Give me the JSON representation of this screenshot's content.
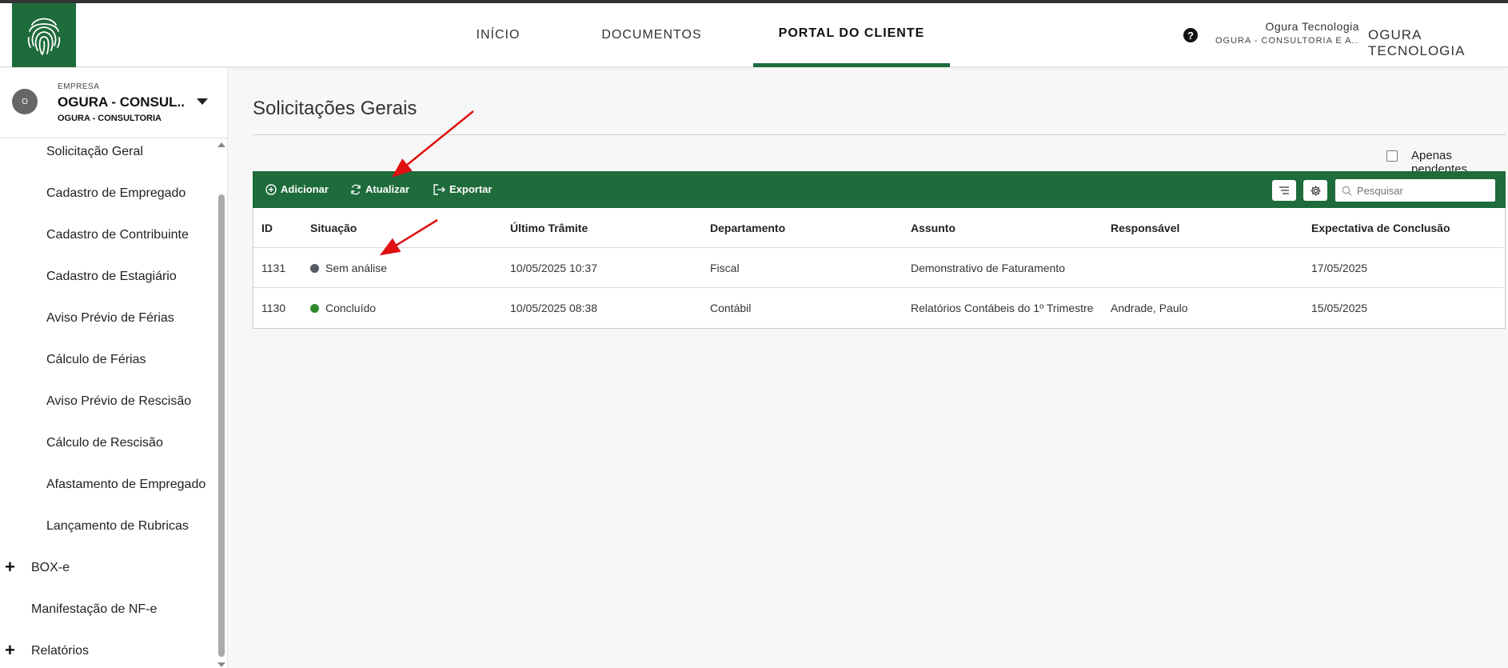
{
  "colors": {
    "brand": "#1e6b3c",
    "status_grey": "#555a63",
    "status_green": "#2f8a2b",
    "annotation_arrow": "#e01010"
  },
  "header": {
    "nav": [
      "INÍCIO",
      "DOCUMENTOS",
      "PORTAL DO CLIENTE"
    ],
    "active_nav": "PORTAL DO CLIENTE",
    "help_glyph": "?",
    "user_name": "Ogura Tecnologia",
    "user_company": "OGURA - CONSULTORIA E A...",
    "company_right": "OGURA TECNOLOGIA"
  },
  "sidebar": {
    "avatar": "O",
    "company_label": "EMPRESA",
    "company_name": "OGURA - CONSUL...",
    "company_sub": "OGURA - CONSULTORIA",
    "items": [
      "Solicitação Geral",
      "Cadastro de Empregado",
      "Cadastro de Contribuinte",
      "Cadastro de Estagiário",
      "Aviso Prévio de Férias",
      "Cálculo de Férias",
      "Aviso Prévio de Rescisão",
      "Cálculo de Rescisão",
      "Afastamento de Empregado",
      "Lançamento de Rubricas"
    ],
    "sections": [
      "BOX-e",
      "Manifestação de NF-e",
      "Relatórios"
    ]
  },
  "main": {
    "title": "Solicitações Gerais",
    "pending_label": "Apenas pendentes",
    "toolbar": {
      "add": "Adicionar",
      "refresh": "Atualizar",
      "export": "Exportar",
      "search_placeholder": "Pesquisar"
    },
    "table": {
      "headers": [
        "ID",
        "Situação",
        "Último Trâmite",
        "Departamento",
        "Assunto",
        "Responsável",
        "Expectativa de Conclusão"
      ],
      "rows": [
        {
          "id": "1131",
          "status": "Sem análise",
          "status_color": "#555a63",
          "last": "10/05/2025 10:37",
          "dept": "Fiscal",
          "subject": "Demonstrativo de Faturamento",
          "resp": "",
          "expected": "17/05/2025"
        },
        {
          "id": "1130",
          "status": "Concluído",
          "status_color": "#2f8a2b",
          "last": "10/05/2025 08:38",
          "dept": "Contábil",
          "subject": "Relatórios Contábeis do 1º Trimestre",
          "resp": "Andrade, Paulo",
          "expected": "15/05/2025"
        }
      ]
    }
  }
}
